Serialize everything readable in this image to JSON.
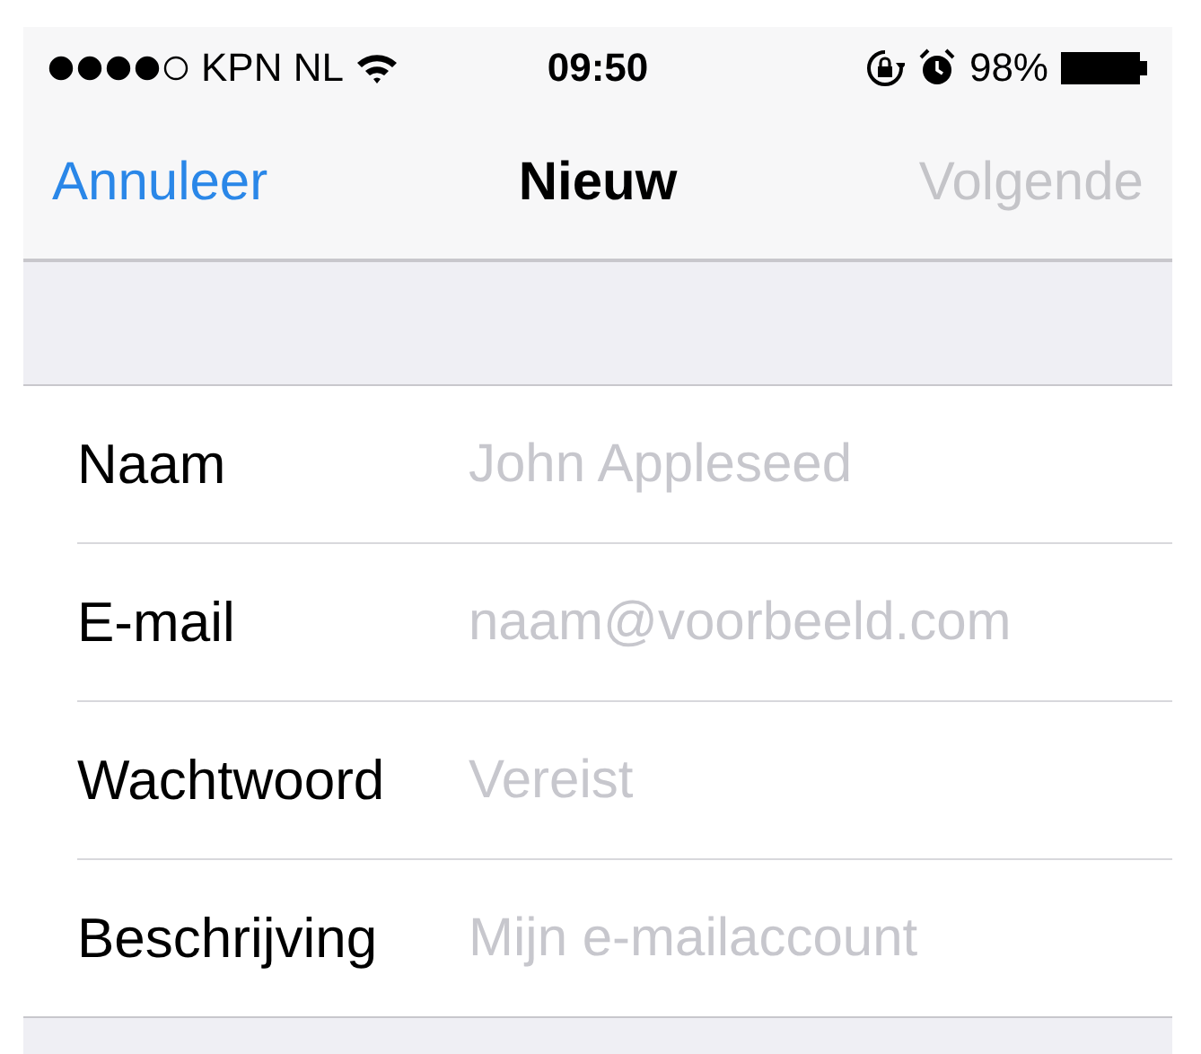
{
  "status_bar": {
    "carrier": "KPN NL",
    "time": "09:50",
    "battery": "98%"
  },
  "nav_bar": {
    "cancel": "Annuleer",
    "title": "Nieuw",
    "next": {
      "label": "Volgende",
      "disabled": true
    }
  },
  "fields": [
    {
      "label": "Naam",
      "placeholder": "John Appleseed"
    },
    {
      "label": "E-mail",
      "placeholder": "naam@voorbeeld.com"
    },
    {
      "label": "Wachtwoord",
      "placeholder": "Vereist"
    },
    {
      "label": "Beschrijving",
      "placeholder": "Mijn e-mailaccount"
    }
  ]
}
